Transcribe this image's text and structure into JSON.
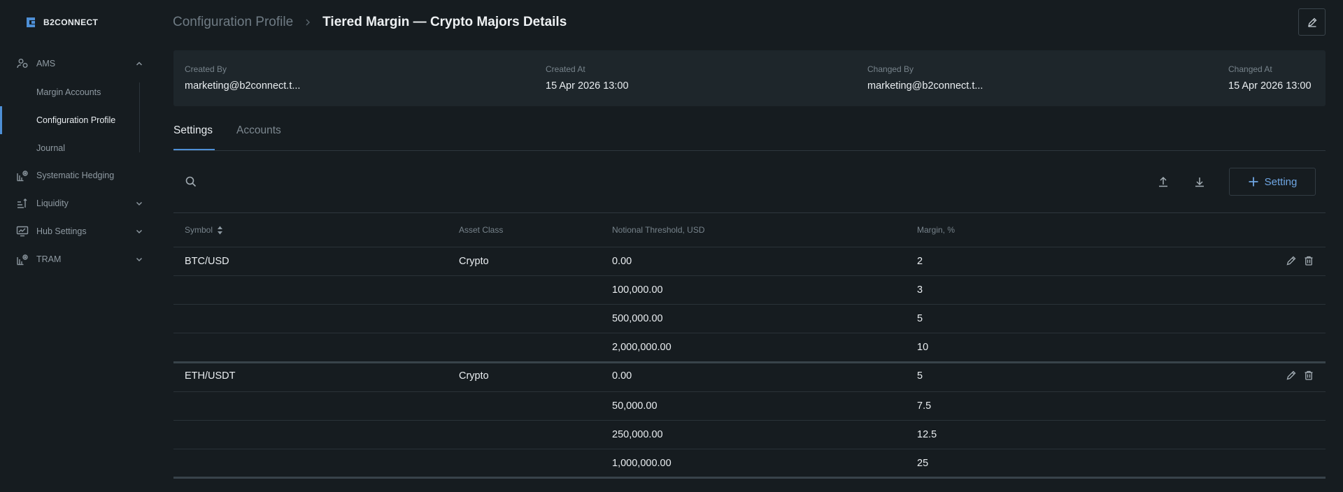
{
  "app": {
    "brand": "B2CONNECT"
  },
  "sidebar": {
    "groups": [
      {
        "label": "AMS",
        "icon": "users-icon",
        "expanded": true,
        "items": [
          {
            "label": "Margin Accounts"
          },
          {
            "label": "Configuration Profile",
            "active": true
          },
          {
            "label": "Journal"
          }
        ]
      },
      {
        "label": "Systematic Hedging",
        "icon": "chart-gear-icon"
      },
      {
        "label": "Liquidity",
        "icon": "liquidity-icon",
        "expanded": false
      },
      {
        "label": "Hub Settings",
        "icon": "monitor-chart-icon",
        "expanded": false
      },
      {
        "label": "TRAM",
        "icon": "chart-gear-icon",
        "expanded": false
      }
    ]
  },
  "header": {
    "breadcrumb_parent": "Configuration Profile",
    "title": "Tiered Margin — Crypto Majors Details"
  },
  "info": {
    "created_by_label": "Created By",
    "created_by": "marketing@b2connect.t...",
    "created_at_label": "Created At",
    "created_at": "15 Apr 2026 13:00",
    "changed_by_label": "Changed By",
    "changed_by": "marketing@b2connect.t...",
    "changed_at_label": "Changed At",
    "changed_at": "15 Apr 2026 13:00"
  },
  "tabs": [
    {
      "label": "Settings",
      "active": true
    },
    {
      "label": "Accounts",
      "active": false
    }
  ],
  "toolbar": {
    "add_label": "Setting"
  },
  "table": {
    "columns": [
      "Symbol",
      "Asset Class",
      "Notional Threshold, USD",
      "Margin, %"
    ],
    "groups": [
      {
        "symbol": "BTC/USD",
        "asset_class": "Crypto",
        "tiers": [
          {
            "threshold": "0.00",
            "margin": "2"
          },
          {
            "threshold": "100,000.00",
            "margin": "3"
          },
          {
            "threshold": "500,000.00",
            "margin": "5"
          },
          {
            "threshold": "2,000,000.00",
            "margin": "10"
          }
        ]
      },
      {
        "symbol": "ETH/USDT",
        "asset_class": "Crypto",
        "tiers": [
          {
            "threshold": "0.00",
            "margin": "5"
          },
          {
            "threshold": "50,000.00",
            "margin": "7.5"
          },
          {
            "threshold": "250,000.00",
            "margin": "12.5"
          },
          {
            "threshold": "1,000,000.00",
            "margin": "25"
          }
        ]
      }
    ]
  },
  "colors": {
    "accent": "#4e8fd6",
    "background": "#161c20",
    "card": "#1e262b",
    "link_button": "#6fa6e3"
  }
}
